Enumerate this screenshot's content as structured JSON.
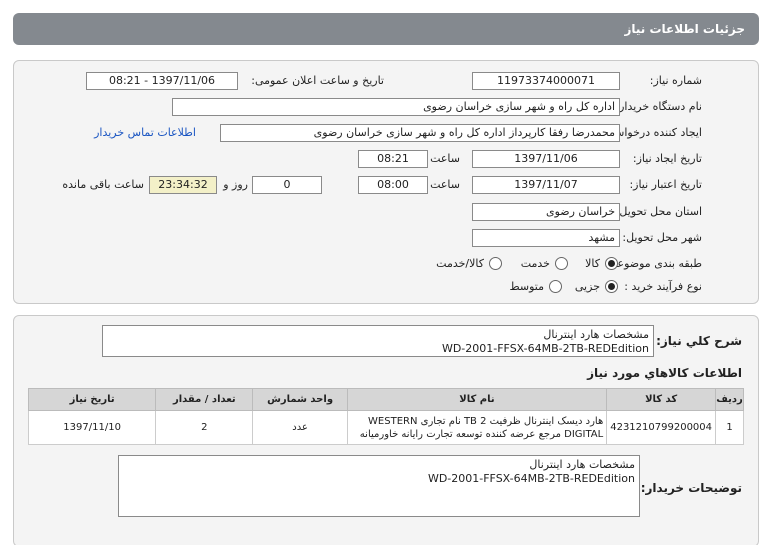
{
  "header": {
    "title": "جزئیات اطلاعات نیاز"
  },
  "form": {
    "need_number": {
      "label": "شماره نیاز:",
      "value": "11973374000071"
    },
    "announce": {
      "label": "تاریخ و ساعت اعلان عمومی:",
      "value": "1397/11/06 - 08:21"
    },
    "buyer_org": {
      "label": "نام دستگاه خریدار:",
      "value": "اداره کل راه و شهر سازی خراسان رضوی"
    },
    "requester": {
      "label": "ایجاد کننده درخواست:",
      "value": "محمدرضا رفقا کارپرداز اداره کل راه و شهر سازی خراسان رضوی",
      "contact_link": "اطلاعات تماس خریدار"
    },
    "created": {
      "label": "تاریخ ایجاد نیاز:",
      "date": "1397/11/06",
      "time_label": "ساعت",
      "time": "08:21"
    },
    "validity": {
      "label": "تاریخ اعتبار نیاز:",
      "date": "1397/11/07",
      "time_label": "ساعت",
      "time": "08:00",
      "days": "0",
      "days_label": "روز و",
      "remaining": "23:34:32",
      "remaining_label": "ساعت باقی مانده"
    },
    "province": {
      "label": "استان محل تحویل:",
      "value": "خراسان رضوی"
    },
    "city": {
      "label": "شهر محل تحویل:",
      "value": "مشهد"
    },
    "category": {
      "label": "طبقه بندی موضوعی:",
      "options": [
        "کالا",
        "خدمت",
        "کالا/خدمت"
      ],
      "selected": "کالا"
    },
    "process": {
      "label": "نوع فرآیند خرید :",
      "options": [
        "جزیی",
        "متوسط"
      ],
      "selected": "جزیی"
    }
  },
  "summary": {
    "label": "شرح کلي نياز:",
    "line1": "مشخصات هارد اینترنال",
    "line2": "WD-2001-FFSX-64MB-2TB-REDEdition"
  },
  "items_section": {
    "title": "اطلاعات کالاهاي مورد نياز",
    "headers": [
      "رديف",
      "کد کالا",
      "نام کالا",
      "واحد شمارش",
      "تعداد / مقدار",
      "تاریخ نیاز"
    ],
    "rows": [
      {
        "index": "1",
        "code": "4231210799200004",
        "name_line1": "هارد دیسک اینترنال ظرفیت 2 TB نام تجاری WESTERN",
        "name_line2": "DIGITAL مرجع عرضه کننده توسعه تجارت رایانه خاورمیانه",
        "unit": "عدد",
        "qty": "2",
        "date": "1397/11/10"
      }
    ]
  },
  "buyer_notes": {
    "label": "توضیحات خریدار:",
    "line1": "مشخصات هارد اینترنال",
    "line2": "WD-2001-FFSX-64MB-2TB-REDEdition"
  }
}
